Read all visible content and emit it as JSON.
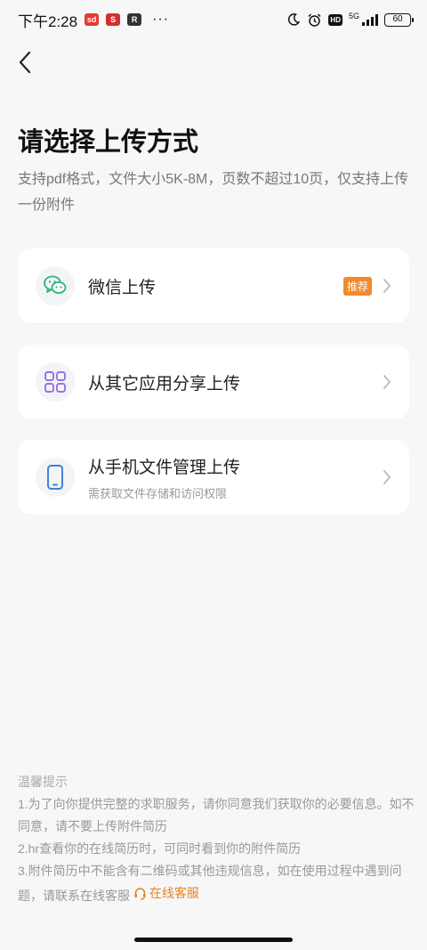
{
  "status_bar": {
    "time": "下午2:28",
    "app1": "sd",
    "app2": "S",
    "app3": "R",
    "dots": "···",
    "hd": "HD",
    "network": "5G",
    "battery": "60"
  },
  "page": {
    "title": "请选择上传方式",
    "subtitle": "支持pdf格式，文件大小5K-8M，页数不超过10页，仅支持上传一份附件"
  },
  "options": [
    {
      "label": "微信上传",
      "badge": "推荐",
      "icon": "wechat-icon",
      "color": "#2bb57a"
    },
    {
      "label": "从其它应用分享上传",
      "icon": "apps-grid-icon",
      "color": "#9b6ee8"
    },
    {
      "label": "从手机文件管理上传",
      "desc": "需获取文件存储和访问权限",
      "icon": "phone-icon",
      "color": "#3f7fd6"
    }
  ],
  "tips": {
    "title": "温馨提示",
    "line1": "1.为了向你提供完整的求职服务，请你同意我们获取你的必要信息。如不同意，请不要上传附件简历",
    "line2": "2.hr查看你的在线简历时，可同时看到你的附件简历",
    "line3": "3.附件简历中不能含有二维码或其他违规信息，如在使用过程中遇到问题，请联系在线客服",
    "service_link": "在线客服",
    "accent_color": "#e5821f"
  }
}
